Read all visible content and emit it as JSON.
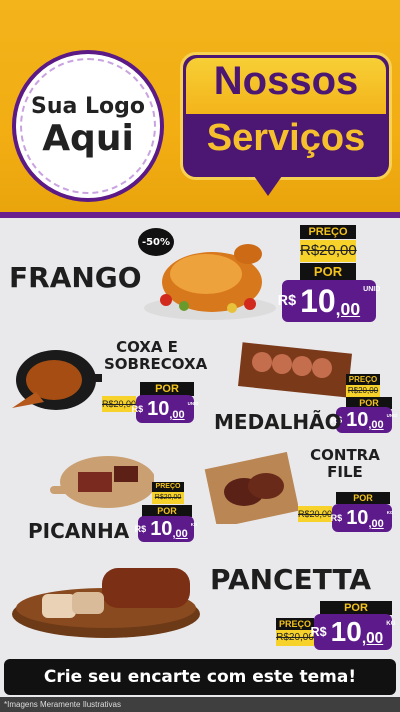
{
  "header": {
    "logo_line1": "Sua Logo",
    "logo_line2": "Aqui",
    "title_line1": "Nossos",
    "title_line2": "Serviços"
  },
  "products": [
    {
      "name": "FRANGO",
      "badge": "-50%",
      "price_label": "PREÇO",
      "old_price": "R$20,00",
      "por": "POR",
      "currency": "R$",
      "price_int": "10",
      "price_cents": ",00",
      "unit": "UNID"
    },
    {
      "name_line1": "COXA E",
      "name_line2": "SOBRECOXA",
      "old_price": "R$20,00",
      "por": "POR",
      "currency": "R$",
      "price_int": "10",
      "price_cents": ",00",
      "unit": "UNID"
    },
    {
      "name": "MEDALHÃO",
      "price_label": "PREÇO",
      "old_price": "R$20,00",
      "por": "POR",
      "currency": "R$",
      "price_int": "10",
      "price_cents": ",00",
      "unit": "UNID"
    },
    {
      "name": "PICANHA",
      "price_label": "PREÇO",
      "old_price": "R$20,00",
      "por": "POR",
      "currency": "R$",
      "price_int": "10",
      "price_cents": ",00",
      "unit": "KG"
    },
    {
      "name_line1": "CONTRA",
      "name_line2": "FILE",
      "old_price": "R$20,00",
      "por": "POR",
      "currency": "R$",
      "price_int": "10",
      "price_cents": ",00",
      "unit": "KG"
    },
    {
      "name": "PANCETTA",
      "price_label": "PREÇO",
      "old_price": "R$20,00",
      "por": "POR",
      "currency": "R$",
      "price_int": "10",
      "price_cents": ",00",
      "unit": "KG"
    }
  ],
  "cta": "Crie seu encarte com este tema!",
  "footer_note": "*Imagens Meramente Ilustrativas",
  "colors": {
    "yellow": "#f3b31b",
    "purple": "#5c1a8a",
    "black": "#111111"
  }
}
